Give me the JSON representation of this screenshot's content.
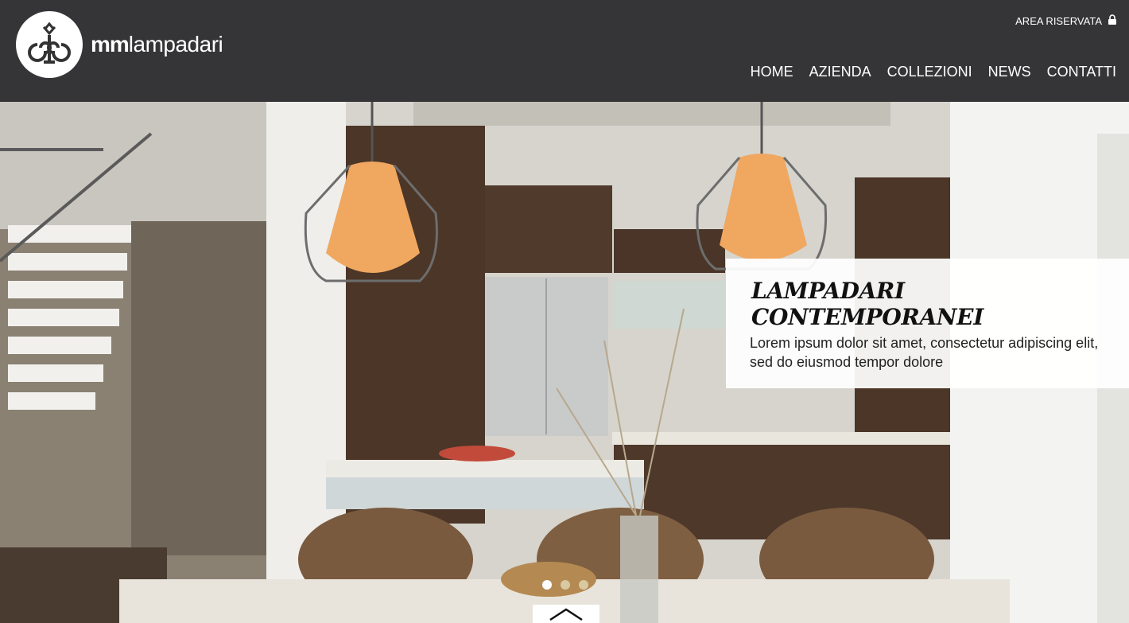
{
  "brand": {
    "name_bold": "mm",
    "name_light": "lampadari"
  },
  "header": {
    "reserved_area": "AREA RISERVATA",
    "nav": [
      {
        "label": "HOME"
      },
      {
        "label": "AZIENDA"
      },
      {
        "label": "COLLEZIONI"
      },
      {
        "label": "NEWS"
      },
      {
        "label": "CONTATTI"
      }
    ]
  },
  "slide": {
    "title": "LAMPADARI CONTEMPORANEI",
    "text": "Lorem ipsum dolor sit amet, consectetur adipiscing elit, sed do eiusmod tempor dolore"
  },
  "slider": {
    "total": 3,
    "active": 1
  },
  "colors": {
    "header_bg": "#353537",
    "dot_active": "#ffffff",
    "dot_inactive": "#d8c9a0"
  },
  "icons": {
    "lock": "lock-icon",
    "scroll_top": "chevron-up-icon"
  }
}
